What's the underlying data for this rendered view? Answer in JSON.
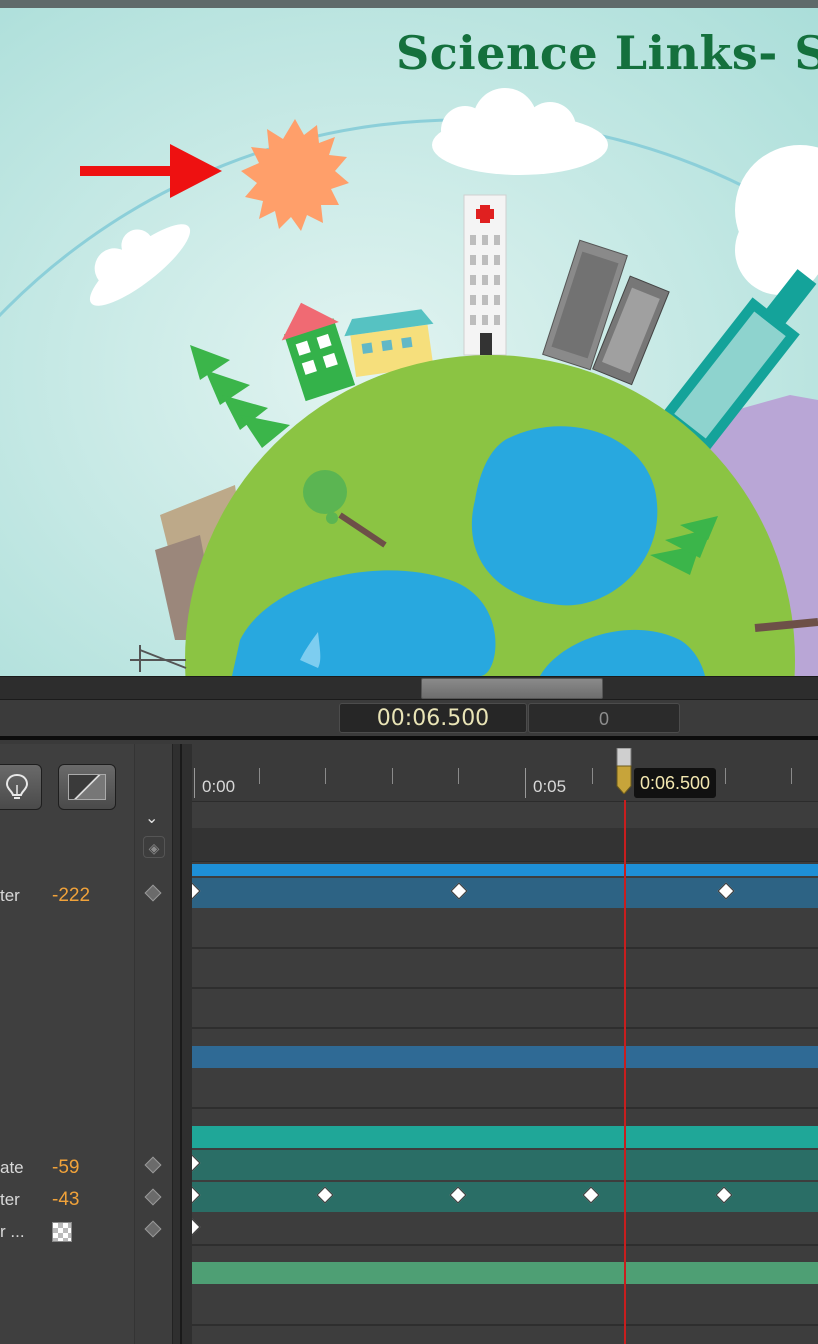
{
  "canvas": {
    "title": "Science Links- S"
  },
  "transport": {
    "time": "00:06.500",
    "frame": "0"
  },
  "toolbar": {
    "light_icon": "lightbulb-icon",
    "gradient_icon": "gradient-swatch-icon",
    "expand_icon": "chevron-down-icon",
    "link_icon": "link-keyframes-icon"
  },
  "ruler": {
    "labels": [
      "0:00",
      "0:05"
    ],
    "playhead_label": "0:06.500"
  },
  "properties": [
    {
      "label": "ter",
      "value": "-222"
    },
    {
      "label": "ate",
      "value": "-59"
    },
    {
      "label": "ter",
      "value": "-43"
    },
    {
      "label": "r ...",
      "value": ""
    }
  ],
  "colors": {
    "playhead": "#c81e1e",
    "value_orange": "#f0a23a",
    "title_green": "#14703d"
  }
}
